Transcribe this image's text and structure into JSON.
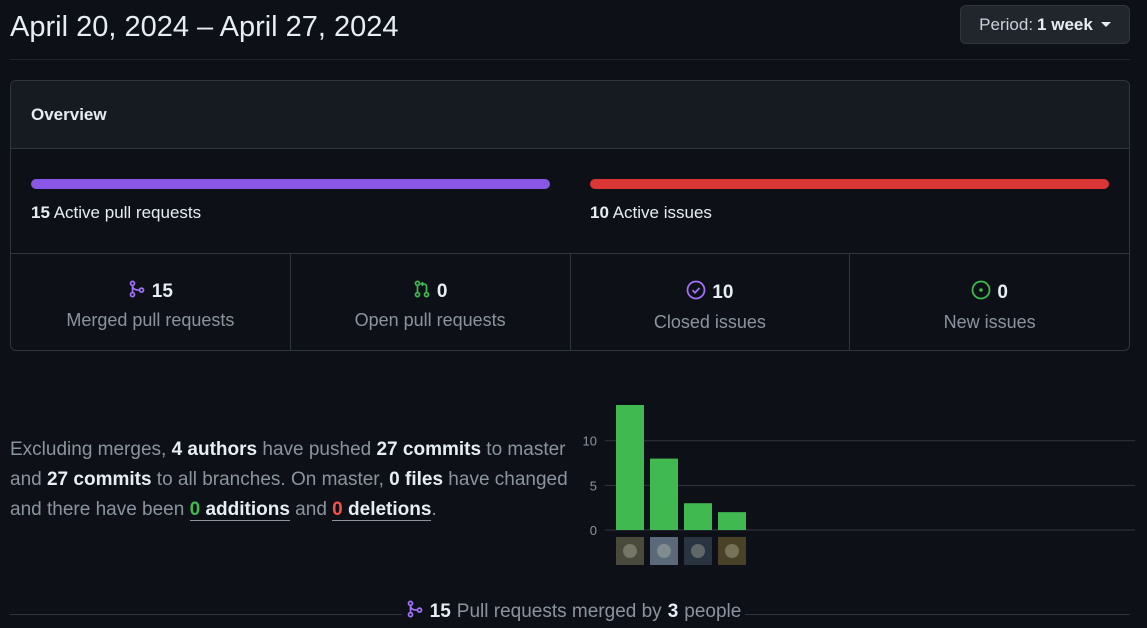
{
  "header": {
    "date_range": "April 20, 2024 – April 27, 2024",
    "period_label": "Period:",
    "period_value": "1 week"
  },
  "overview": {
    "title": "Overview",
    "pull_requests": {
      "count": "15",
      "label": "Active pull requests",
      "color": "#8957e5"
    },
    "issues": {
      "count": "10",
      "label": "Active issues",
      "color": "#da3633"
    },
    "stats": [
      {
        "icon": "merge-icon",
        "value": "15",
        "label": "Merged pull requests",
        "color": "#a371f7"
      },
      {
        "icon": "pull-request-icon",
        "value": "0",
        "label": "Open pull requests",
        "color": "#3fb950"
      },
      {
        "icon": "issue-closed-icon",
        "value": "10",
        "label": "Closed issues",
        "color": "#a371f7"
      },
      {
        "icon": "issue-opened-icon",
        "value": "0",
        "label": "New issues",
        "color": "#3fb950"
      }
    ]
  },
  "summary": {
    "t1": "Excluding merges, ",
    "authors": "4 authors",
    "t2": " have pushed ",
    "commits_master": "27 commits",
    "t3": " to master and ",
    "commits_all": "27 commits",
    "t4": " to all branches. On master, ",
    "files": "0 files",
    "t5": " have changed and there have been ",
    "additions_num": "0",
    "additions_word": " additions",
    "t6": " and ",
    "deletions_num": "0",
    "deletions_word": " deletions",
    "t7": "."
  },
  "chart_data": {
    "type": "bar",
    "categories": [
      "contributor 1",
      "contributor 2",
      "contributor 3",
      "contributor 4"
    ],
    "values": [
      14,
      8,
      3,
      2
    ],
    "yticks": [
      "0",
      "5",
      "10"
    ],
    "ylim": [
      0,
      14
    ],
    "bar_color": "#3fb950",
    "grid": true
  },
  "footer": {
    "count": "15",
    "t1": "Pull requests merged by",
    "people": "3",
    "t2": "people"
  }
}
